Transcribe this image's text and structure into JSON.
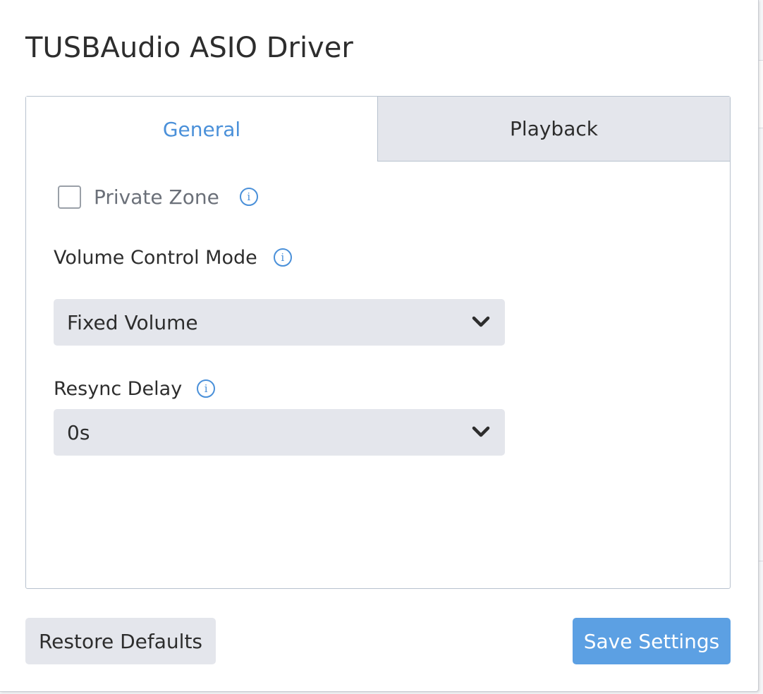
{
  "dialog": {
    "title": "TUSBAudio ASIO Driver"
  },
  "tabs": [
    {
      "label": "General",
      "active": true
    },
    {
      "label": "Playback",
      "active": false
    }
  ],
  "general": {
    "private_zone": {
      "label": "Private Zone",
      "checked": false,
      "info_icon": "info-icon"
    },
    "volume_control_mode": {
      "label": "Volume Control Mode",
      "value": "Fixed Volume",
      "info_icon": "info-icon"
    },
    "resync_delay": {
      "label": "Resync Delay",
      "value": "0s",
      "info_icon": "info-icon"
    }
  },
  "buttons": {
    "restore_defaults": "Restore Defaults",
    "save_settings": "Save Settings"
  },
  "colors": {
    "accent": "#4a90d9",
    "primary_button": "#5ca0e3",
    "control_background": "#e4e6ec",
    "panel_border": "#b8c2ce",
    "text": "#2d2d2d",
    "muted_text": "#6b7079"
  }
}
